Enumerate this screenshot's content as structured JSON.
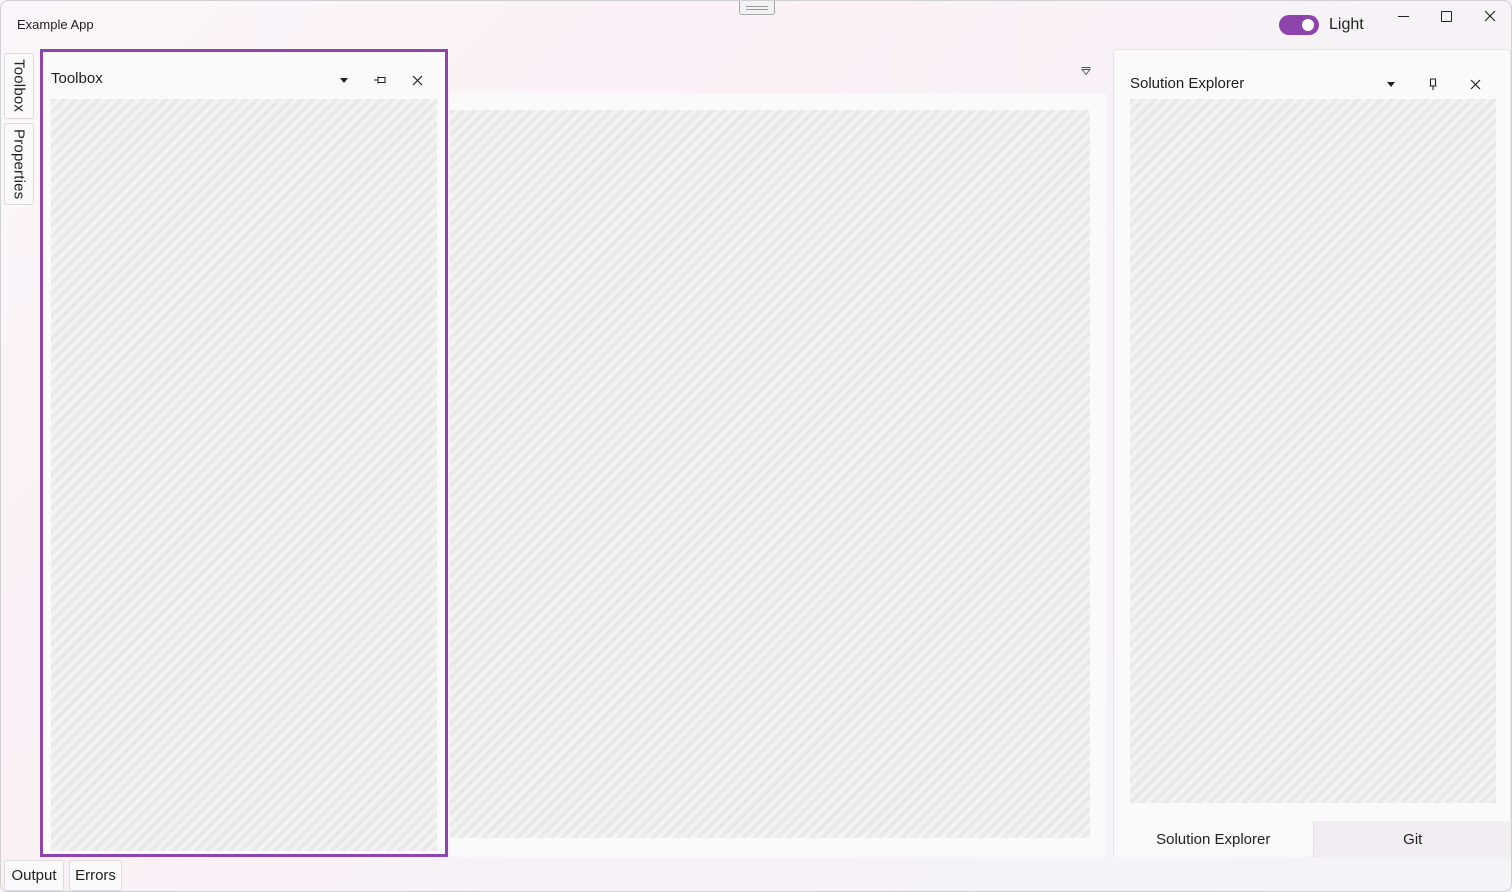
{
  "app": {
    "title": "Example App"
  },
  "theme": {
    "label": "Light",
    "enabled": true,
    "accent": "#8e44ad"
  },
  "left_tabs": [
    {
      "label": "Toolbox"
    },
    {
      "label": "Properties"
    }
  ],
  "toolbox": {
    "title": "Toolbox"
  },
  "solution_explorer": {
    "title": "Solution Explorer",
    "tabs": [
      {
        "label": "Solution Explorer"
      },
      {
        "label": "Git"
      }
    ]
  },
  "bottom_tabs": [
    {
      "label": "Output"
    },
    {
      "label": "Errors"
    }
  ],
  "icons": {
    "dropdown": "chevron-down-icon",
    "pin": "pin-icon",
    "close": "close-icon",
    "minimize": "minimize-icon",
    "maximize": "maximize-icon"
  }
}
